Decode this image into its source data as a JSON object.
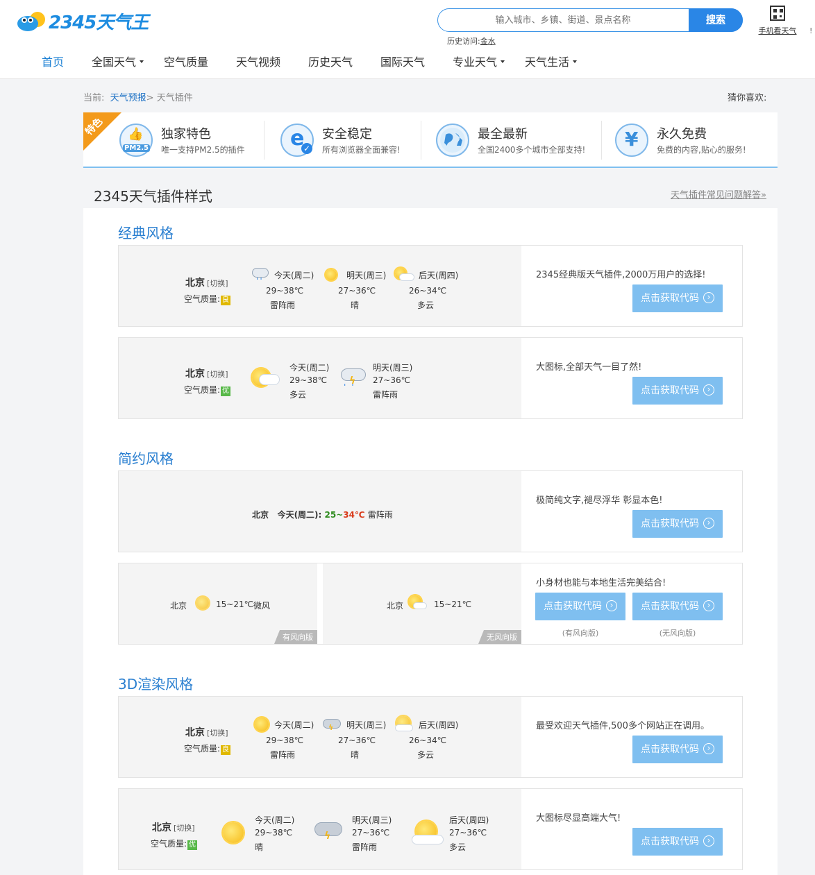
{
  "header": {
    "logo_text": "2345天气王",
    "search_placeholder": "输入城市、乡镇、街道、景点名称",
    "search_button": "搜索",
    "history_label": "历史访问:",
    "history_link": "金水",
    "mobile_label": "手机看天气",
    "edge_mark": "!"
  },
  "nav": [
    {
      "label": "首页",
      "active": true,
      "caret": false
    },
    {
      "label": "全国天气",
      "caret": true
    },
    {
      "label": "空气质量",
      "caret": false
    },
    {
      "label": "天气视频",
      "caret": false
    },
    {
      "label": "历史天气",
      "caret": false
    },
    {
      "label": "国际天气",
      "caret": false
    },
    {
      "label": "专业天气",
      "caret": true
    },
    {
      "label": "天气生活",
      "caret": true
    }
  ],
  "breadcrumb": {
    "prefix": "当前:",
    "parent": "天气预报",
    "sep": ">",
    "current": "天气插件"
  },
  "guess": "猜你喜欢:",
  "features": {
    "ribbon": "特色",
    "items": [
      {
        "title": "独家特色",
        "desc": "唯一支持PM2.5的插件",
        "icon_text": "PM2.5",
        "icon": "thumbs-up-icon"
      },
      {
        "title": "安全稳定",
        "desc": "所有浏览器全面兼容!",
        "icon_text": "e",
        "icon": "browser-icon"
      },
      {
        "title": "最全最新",
        "desc": "全国2400多个城市全部支持!",
        "icon_text": "",
        "icon": "globe-icon"
      },
      {
        "title": "永久免费",
        "desc": "免费的内容,贴心的服务!",
        "icon_text": "¥",
        "icon": "yen-icon"
      }
    ]
  },
  "section_title": "2345天气插件样式",
  "faq_link": "天气插件常见问题解答»",
  "common": {
    "city": "北京",
    "switch": "[切换]",
    "aq_label": "空气质量:",
    "aq_liang": "良",
    "aq_you": "优",
    "get_code": "点击获取代码"
  },
  "classic": {
    "heading": "经典风格",
    "card1": {
      "desc": "2345经典版天气插件,2000万用户的选择!",
      "days": [
        {
          "name": "今天(周二)",
          "temp": "29~38℃",
          "weather": "雷阵雨"
        },
        {
          "name": "明天(周三)",
          "temp": "27~36℃",
          "weather": "晴"
        },
        {
          "name": "后天(周四)",
          "temp": "26~34℃",
          "weather": "多云"
        }
      ]
    },
    "card2": {
      "desc": "大图标,全部天气一目了然!",
      "days": [
        {
          "name": "今天(周二)",
          "temp": "29~38℃",
          "weather": "多云"
        },
        {
          "name": "明天(周三)",
          "temp": "27~36℃",
          "weather": "雷阵雨"
        }
      ]
    }
  },
  "simple": {
    "heading": "简约风格",
    "card1": {
      "desc": "极简纯文字,褪尽浮华 彰显本色!",
      "today": "今天(周二):",
      "temp": "25~34℃",
      "weather": "雷阵雨"
    },
    "card2": {
      "desc": "小身材也能与本地生活完美结合!",
      "left_temp": "15~21℃",
      "left_wind": "微风",
      "left_tag": "有风向版",
      "right_temp": "15~21℃",
      "right_tag": "无风向版",
      "sub_left": "(有风向版)",
      "sub_right": "(无风向版)"
    }
  },
  "render3d": {
    "heading": "3D渲染风格",
    "card1": {
      "desc": "最受欢迎天气插件,500多个网站正在调用。",
      "days": [
        {
          "name": "今天(周二)",
          "temp": "29~38℃",
          "weather": "雷阵雨"
        },
        {
          "name": "明天(周三)",
          "temp": "27~36℃",
          "weather": "晴"
        },
        {
          "name": "后天(周四)",
          "temp": "26~34℃",
          "weather": "多云"
        }
      ]
    },
    "card2": {
      "desc": "大图标尽显高端大气!",
      "days": [
        {
          "name": "今天(周二)",
          "temp": "29~38℃",
          "weather": "晴"
        },
        {
          "name": "明天(周三)",
          "temp": "27~36℃",
          "weather": "雷阵雨"
        },
        {
          "name": "后天(周四)",
          "temp": "27~36℃",
          "weather": "多云"
        }
      ]
    }
  },
  "colors": {
    "brand": "#2a86e6",
    "button": "#7fbff0",
    "ribbon": "#f39a1b",
    "temp_low": "#2e8b1e",
    "temp_high": "#d93a1a"
  }
}
